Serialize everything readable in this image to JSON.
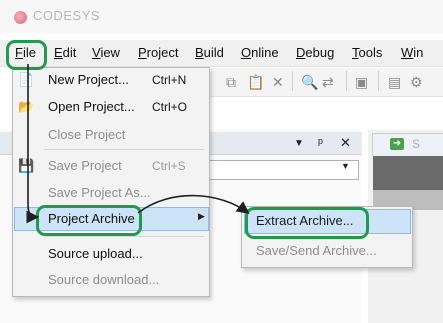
{
  "app": {
    "title": "CODESYS"
  },
  "menubar": {
    "items": [
      {
        "label": "File",
        "underline": "F",
        "rest": "ile"
      },
      {
        "label": "Edit",
        "underline": "E",
        "rest": "dit"
      },
      {
        "label": "View",
        "underline": "V",
        "rest": "iew"
      },
      {
        "label": "Project",
        "underline": "P",
        "rest": "roject"
      },
      {
        "label": "Build",
        "underline": "B",
        "rest": "uild"
      },
      {
        "label": "Online",
        "underline": "O",
        "rest": "nline"
      },
      {
        "label": "Debug",
        "underline": "D",
        "rest": "ebug"
      },
      {
        "label": "Tools",
        "underline": "T",
        "rest": "ools"
      },
      {
        "label": "Win",
        "underline": "W",
        "rest": "in"
      }
    ]
  },
  "file_menu": {
    "new_project": {
      "label": "New Project...",
      "shortcut": "Ctrl+N"
    },
    "open_project": {
      "label": "Open Project...",
      "shortcut": "Ctrl+O"
    },
    "close_project": {
      "label": "Close Project"
    },
    "save_project": {
      "label": "Save Project",
      "shortcut": "Ctrl+S"
    },
    "save_project_as": {
      "label": "Save Project As..."
    },
    "project_archive": {
      "label": "Project Archive"
    },
    "source_upload": {
      "label": "Source upload..."
    },
    "source_download": {
      "label": "Source download..."
    }
  },
  "archive_submenu": {
    "extract": {
      "label": "Extract Archive..."
    },
    "save_send": {
      "label": "Save/Send Archive..."
    }
  },
  "panel": {
    "controls": [
      "▼",
      "ᵖ",
      "✕"
    ]
  },
  "right_tab": {
    "label": "S"
  },
  "colors": {
    "callout": "#1f9a4f",
    "highlight": "#cde3f7",
    "highlight_border": "#8fb9e6"
  }
}
